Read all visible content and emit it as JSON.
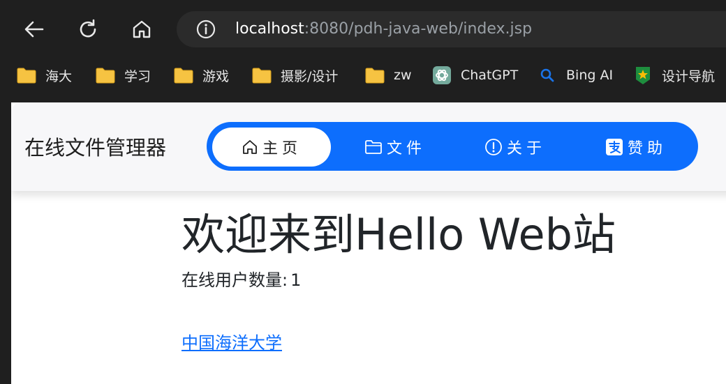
{
  "browser": {
    "url_host": "localhost",
    "url_rest": ":8080/pdh-java-web/index.jsp",
    "bookmarks": [
      {
        "label": "海大",
        "icon": "folder-icon"
      },
      {
        "label": "学习",
        "icon": "folder-icon"
      },
      {
        "label": "游戏",
        "icon": "folder-icon"
      },
      {
        "label": "摄影/设计",
        "icon": "folder-icon"
      },
      {
        "label": "zw",
        "icon": "folder-icon"
      },
      {
        "label": "ChatGPT",
        "icon": "chatgpt-icon"
      },
      {
        "label": "Bing AI",
        "icon": "search-icon"
      },
      {
        "label": "设计导航",
        "icon": "star-badge-icon"
      }
    ]
  },
  "navbar": {
    "brand": "在线文件管理器",
    "items": [
      {
        "label": "主页",
        "icon": "home-icon",
        "active": true
      },
      {
        "label": "文件",
        "icon": "folder-icon",
        "active": false
      },
      {
        "label": "关于",
        "icon": "info-circle-icon",
        "active": false
      },
      {
        "label": "赞助",
        "icon": "alipay-icon",
        "active": false
      }
    ],
    "accent_color": "#0d6efd"
  },
  "main": {
    "welcome": "欢迎来到Hello Web站",
    "online_label": "在线用户数量:",
    "online_count": "1",
    "link_text": "中国海洋大学",
    "link_color": "#0d6efd"
  }
}
